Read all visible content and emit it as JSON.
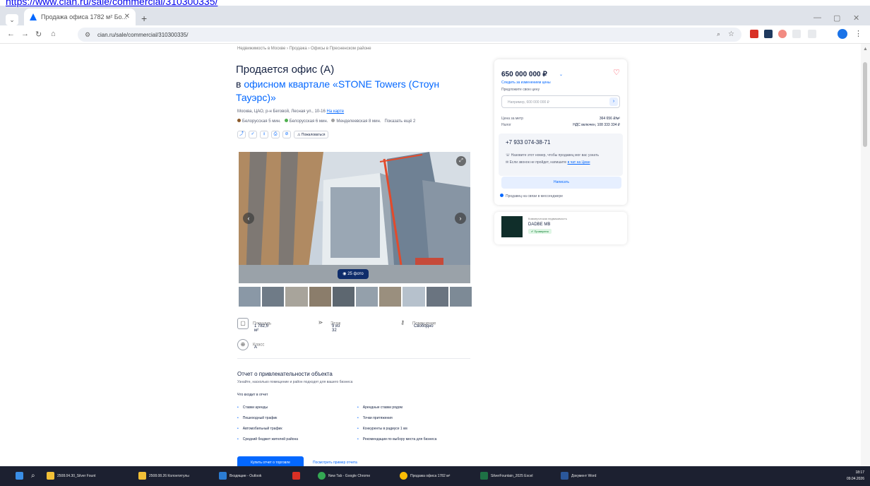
{
  "page_url": "https://www.cian.ru/sale/commercial/310300335/",
  "browser": {
    "tab_title": "Продажа офиса 1782 м² Бо...",
    "omnibox_url": "cian.ru/sale/commercial/310300335/"
  },
  "listing": {
    "breadcrumb": "Недвижимость в Москве › Продажа › Офисы в Пресненском районе",
    "title": "Продается офис (А)",
    "subtitle_prefix": "в ",
    "subtitle_link": "офисном квартале «STONE Towers (Стоун Тауэрс)»",
    "address": "Москва, ЦАО, р-н Беговой, Лесная ул., 10-16 ",
    "address_link": "На карте",
    "metro": [
      {
        "name": "Белорусская",
        "time": "5 мин.",
        "color": "#8b5a2b"
      },
      {
        "name": "Белорусская",
        "time": "6 мин.",
        "color": "#4fb04f"
      },
      {
        "name": "Менделеевская",
        "time": "8 мин.",
        "color": "#a0a0a0"
      }
    ],
    "metro_more": "Показать ещё 2",
    "report_button": "Пожаловаться",
    "photo_count": "25 фото"
  },
  "features": [
    {
      "label": "Площадь",
      "value": "1 782,5 м²",
      "icon": "area-icon"
    },
    {
      "label": "Этаж",
      "value": "9 из 32",
      "icon": "floor-icon"
    },
    {
      "label": "Помещение",
      "value": "Свободно",
      "icon": "key-icon"
    },
    {
      "label": "Класс",
      "value": "А",
      "icon": "building-icon"
    }
  ],
  "report": {
    "title": "Отчет о привлекательности объекта",
    "subtitle": "Узнайте, насколько помещение и район подходят для вашего бизнеса",
    "question": "Что входит в отчет",
    "items": [
      "Ставки аренды",
      "Арендные ставки рядом",
      "Пешеходный трафик",
      "Точки притяжения",
      "Автомобильный трафик",
      "Конкуренты в радиусе 1 км",
      "Средний бюджет жителей района",
      "Рекомендации по выбору места для бизнеса"
    ],
    "get_button": "Купить отчет о торговле",
    "sample_link": "Посмотреть пример отчета"
  },
  "price_card": {
    "price": "650 000 000 ₽",
    "price_dropdown": "⌄",
    "price_link": "Следить за изменением цены",
    "offer_label": "Предложите свою цену",
    "offer_placeholder": "Например, 600 000 000 ₽",
    "specs": [
      {
        "label": "Цена за метр",
        "value": "364 656 ₽/м²"
      },
      {
        "label": "Налог",
        "value": "НДС включен, 108 333 334 ₽"
      }
    ],
    "phone": "+7 933 074-38-71",
    "phone_note1": "Назовите этот номер, чтобы продавец мог вас узнать",
    "phone_note2": "Если звонок не пройдет, напишите ",
    "phone_note2_link": "в чат на Циан",
    "write_button": "Написать",
    "seller_note": "Продавец на связи в мессенджере"
  },
  "agent": {
    "type": "Коммерческая недвижимость",
    "name": "DADBE MB",
    "badge": "Проверено"
  },
  "taskbar": {
    "items": [
      {
        "label": "2508.04.30_Silver Fount",
        "color": "#f2c037"
      },
      {
        "label": "2508.08.26 Колонтитулы",
        "color": "#f2c037"
      },
      {
        "label": "Входящие - Outlook",
        "color": "#2b7cd3"
      },
      {
        "label": "New Tab - Google Chrome",
        "color": "#34a853"
      },
      {
        "label": "Продажа офиса 1782 м²",
        "color": "#fbbc05"
      },
      {
        "label": "SilverFountain_2025 Excel",
        "color": "#1e7145"
      },
      {
        "label": "Документ Word",
        "color": "#2b579a"
      }
    ],
    "time": "18:17",
    "date": "09.04.2026"
  }
}
